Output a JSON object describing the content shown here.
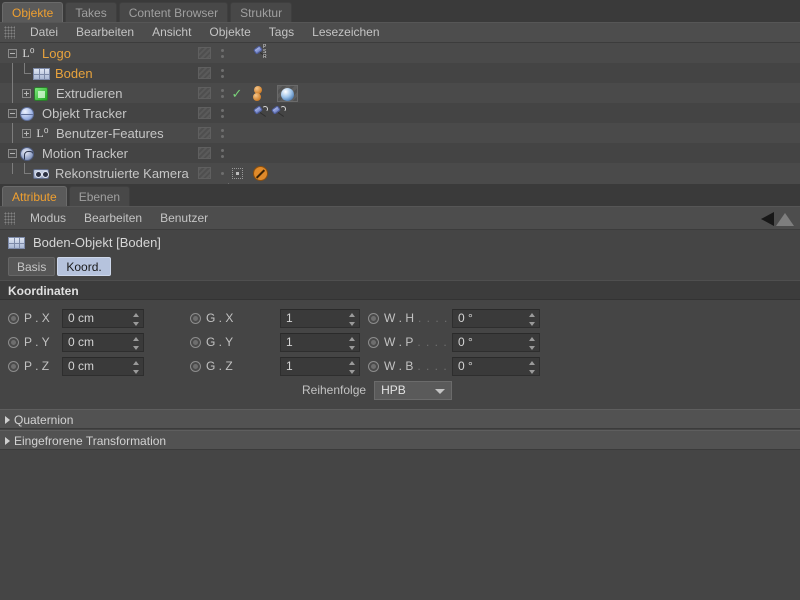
{
  "top_tabs": [
    {
      "label": "Objekte",
      "active": true
    },
    {
      "label": "Takes",
      "active": false
    },
    {
      "label": "Content Browser",
      "active": false
    },
    {
      "label": "Struktur",
      "active": false
    }
  ],
  "object_menu": [
    "Datei",
    "Bearbeiten",
    "Ansicht",
    "Objekte",
    "Tags",
    "Lesezeichen"
  ],
  "objects": [
    {
      "label": "Logo",
      "icon": "null-icon",
      "color": "orange",
      "indent": 0,
      "expander": "minus",
      "tags": [
        "psr-tag"
      ]
    },
    {
      "label": "Boden",
      "icon": "floor-icon",
      "color": "orange",
      "indent": 1,
      "expander": "none",
      "tags": []
    },
    {
      "label": "Extrudieren",
      "icon": "extrude-icon",
      "color": "plain",
      "indent": 1,
      "expander": "plus",
      "mark": "check",
      "tags": [
        "material-dots",
        "material-tag"
      ]
    },
    {
      "label": "Objekt Tracker",
      "icon": "sphere-icon",
      "color": "plain",
      "indent": 0,
      "expander": "minus",
      "tags": [
        "constraint-tag",
        "constraint-tag"
      ]
    },
    {
      "label": "Benutzer-Features",
      "icon": "null-icon",
      "color": "plain",
      "indent": 1,
      "expander": "plus",
      "tags": []
    },
    {
      "label": "Motion Tracker",
      "icon": "motion-tracker-icon",
      "color": "plain",
      "indent": 0,
      "expander": "minus",
      "tags": []
    },
    {
      "label": "Rekonstruierte Kamera",
      "icon": "camera-icon",
      "color": "plain",
      "indent": 1,
      "expander": "none",
      "mark": "xform",
      "tags": [
        "disabled-tag"
      ]
    }
  ],
  "attr_tabs": [
    {
      "label": "Attribute",
      "active": true
    },
    {
      "label": "Ebenen",
      "active": false
    }
  ],
  "attr_menu": [
    "Modus",
    "Bearbeiten",
    "Benutzer"
  ],
  "attr_object_title": "Boden-Objekt [Boden]",
  "attr_subtabs": [
    {
      "label": "Basis",
      "active": false
    },
    {
      "label": "Koord.",
      "active": true
    }
  ],
  "coordinates": {
    "section_title": "Koordinaten",
    "rows": [
      {
        "pos_label": "P . X",
        "pos_value": "0 cm",
        "scale_label": "G . X",
        "scale_value": "1",
        "rot_label": "W . H",
        "rot_dots": ". . . . .",
        "rot_value": "0 °"
      },
      {
        "pos_label": "P . Y",
        "pos_value": "0 cm",
        "scale_label": "G . Y",
        "scale_value": "1",
        "rot_label": "W . P",
        "rot_dots": ". . . . . .",
        "rot_value": "0 °"
      },
      {
        "pos_label": "P . Z",
        "pos_value": "0 cm",
        "scale_label": "G . Z",
        "scale_value": "1",
        "rot_label": "W . B",
        "rot_dots": ". . . . . .",
        "rot_value": "0 °"
      }
    ],
    "order_label": "Reihenfolge",
    "order_value": "HPB"
  },
  "folders": [
    {
      "label": "Quaternion"
    },
    {
      "label": "Eingefrorene Transformation"
    }
  ],
  "colors": {
    "accent_orange": "#f0a030",
    "object_orange": "#e8a33d",
    "active_subtab": "#b6c3dd",
    "panel_bg": "#454545",
    "check_green": "#79d279"
  }
}
